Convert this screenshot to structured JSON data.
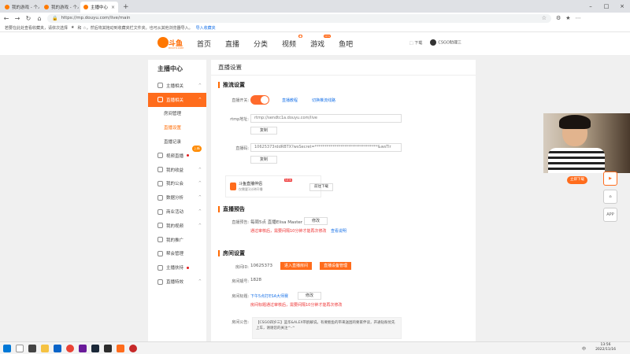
{
  "browser": {
    "tabs": [
      {
        "title": "我的游戏 - 个人中心 - 斗鱼"
      },
      {
        "title": "我的游戏 - 个人中心 - 斗鱼"
      },
      {
        "title": "主播中心"
      }
    ],
    "url": "https://mp.douyu.com/live/main",
    "bookmark_msg": "若要在此处查看收藏夹，请依次选择",
    "bookmark_msg2": "和 ☆，然后将其拖动到收藏夹栏文件夹。也可从其他浏览器导入。",
    "bookmark_import": "导入收藏夹"
  },
  "site": {
    "logo": "斗鱼",
    "logo_sub": "DOUYU.COM",
    "nav": [
      "首页",
      "直播",
      "分类",
      "视频",
      "游戏",
      "鱼吧"
    ],
    "download": "下载",
    "user": "CSGO助理三"
  },
  "sidebar": {
    "title": "主播中心",
    "items": [
      {
        "label": "主播相关",
        "arrow": "^"
      },
      {
        "label": "直播相关",
        "arrow": "^"
      },
      {
        "label": "房间管理"
      },
      {
        "label": "直播设置"
      },
      {
        "label": "直播记录"
      },
      {
        "label": "视频直播",
        "badge": "上新"
      },
      {
        "label": "我的收益",
        "arrow": "^"
      },
      {
        "label": "我的公会",
        "arrow": "^"
      },
      {
        "label": "数据分析",
        "arrow": "^"
      },
      {
        "label": "商业活动",
        "arrow": "^"
      },
      {
        "label": "我的视频",
        "arrow": "^"
      },
      {
        "label": "我的推广"
      },
      {
        "label": "帮会管理"
      },
      {
        "label": "主播扶持"
      },
      {
        "label": "直播特效",
        "arrow": "^"
      }
    ]
  },
  "content": {
    "page_title": "直播设置",
    "push": {
      "heading": "推流设置",
      "switch_label": "直播开关:",
      "tutorial_link": "直播教程",
      "line_link": "切换推流线路",
      "rtmp_label": "rtmp地址:",
      "rtmp_value": "rtmp://sendtc1a.douyu.com/live",
      "copy": "复制",
      "code_label": "直播码:",
      "code_value": "10625373rddRBTX?wsSecret=********************************&wsTir",
      "copy2": "复制"
    },
    "promo": {
      "title": "斗鱼直播伴侣",
      "subtitle": "仅需要1分钟开播",
      "new_tag": "NEW",
      "button": "前往下载"
    },
    "preview": {
      "heading": "直播预告",
      "label": "直播预告:",
      "value": "每周5点 直播Elisa Master",
      "edit": "修改",
      "warn": "通过审核后，需要间隔10分钟才能再次修改",
      "rule_link": "查看说明"
    },
    "room": {
      "heading": "房间设置",
      "id_label": "房间ID:",
      "id_value": "10625373",
      "enter_btn": "进入直播房间",
      "setting_btn": "直播设备管理",
      "number_label": "房间靓号:",
      "number_value": "1828",
      "title_label": "房间标题:",
      "title_value": "下午5点打ESA大师赛",
      "title_edit": "修改",
      "title_warn": "房间标题通过审核后，需要间隔10分钟才能再次修改",
      "notice_label": "房间公告:",
      "notice_text": "【CSGO四岁三】蓝华&ALEX带鸥解说。有要鲍鱼的带来送困的要家伴读，开通钻粉优先上车，谢谢您的关注^-^"
    }
  },
  "overlay": {
    "watch_btn": "立即下载",
    "float_icons": [
      "播放",
      "主页",
      "打开"
    ]
  },
  "taskbar": {
    "time": "13:56",
    "date": "2022/11/16",
    "tray": "中"
  }
}
